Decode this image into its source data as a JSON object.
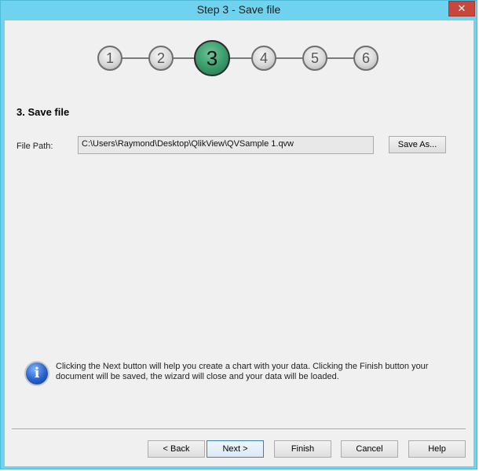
{
  "window": {
    "title": "Step 3 - Save file",
    "close_glyph": "✕"
  },
  "steps": {
    "items": [
      "1",
      "2",
      "3",
      "4",
      "5",
      "6"
    ],
    "active_index": 2
  },
  "section": {
    "title": "3. Save file"
  },
  "file_path": {
    "label": "File Path:",
    "value": "C:\\Users\\Raymond\\Desktop\\QlikView\\QVSample 1.qvw",
    "save_as_label": "Save As..."
  },
  "info": {
    "icon_glyph": "i",
    "text": "Clicking the Next button will help you create a chart with your data. Clicking the Finish button your document will be saved, the wizard will close and your data will be loaded."
  },
  "buttons": {
    "back": "< Back",
    "next": "Next >",
    "finish": "Finish",
    "cancel": "Cancel",
    "help": "Help"
  },
  "colors": {
    "titlebar": "#6fd3ef",
    "close": "#c7473c",
    "active_step": "#3b9e6c",
    "info_icon": "#2860c8"
  }
}
